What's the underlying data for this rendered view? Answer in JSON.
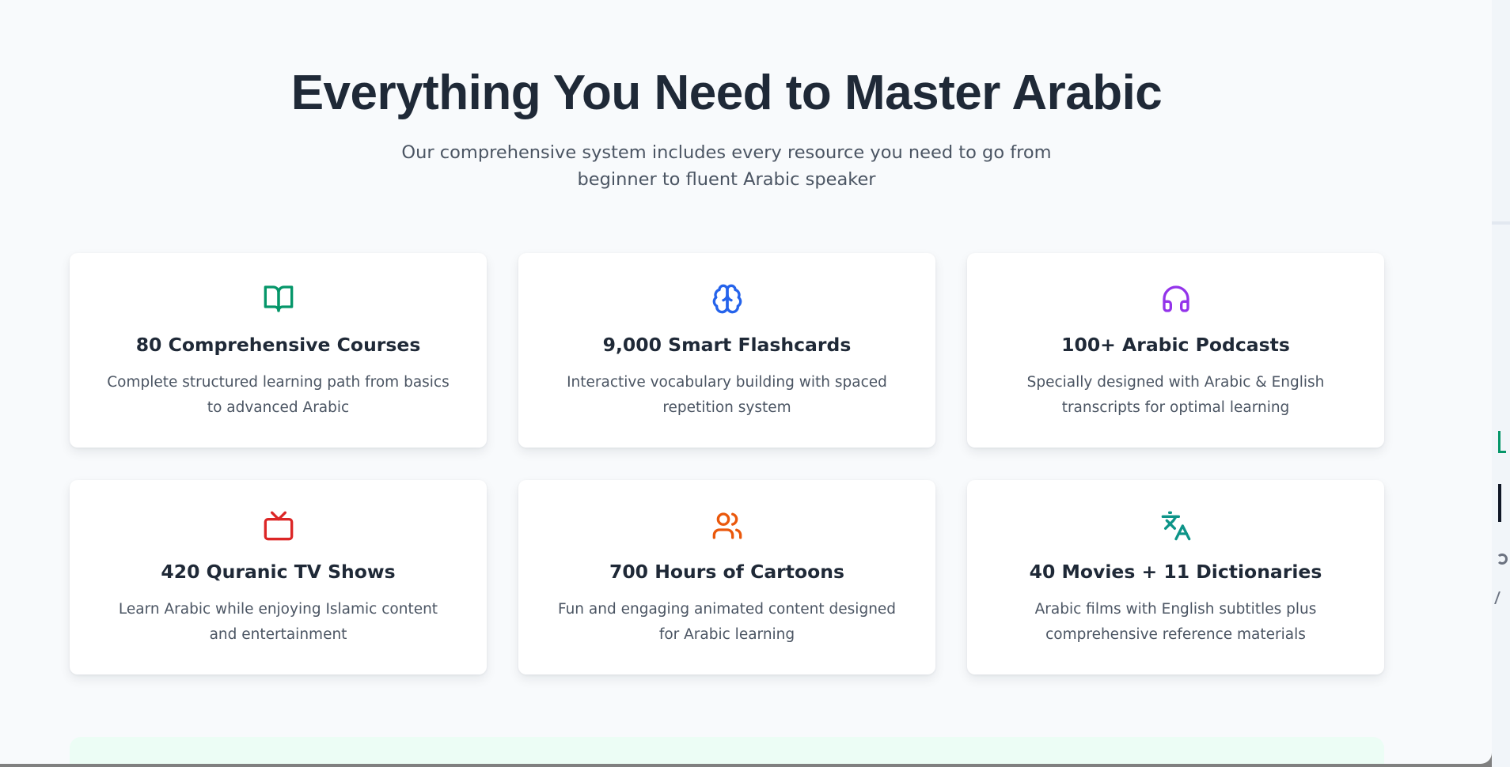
{
  "section": {
    "title": "Everything You Need to Master Arabic",
    "subtitle": "Our comprehensive system includes every resource you need to go from beginner to fluent Arabic speaker"
  },
  "features": [
    {
      "icon": "book-open-icon",
      "color": "#059669",
      "title": "80 Comprehensive Courses",
      "description": "Complete structured learning path from basics to advanced Arabic"
    },
    {
      "icon": "brain-icon",
      "color": "#2563eb",
      "title": "9,000 Smart Flashcards",
      "description": "Interactive vocabulary building with spaced repetition system"
    },
    {
      "icon": "headphones-icon",
      "color": "#9333ea",
      "title": "100+ Arabic Podcasts",
      "description": "Specially designed with Arabic & English transcripts for optimal learning"
    },
    {
      "icon": "tv-icon",
      "color": "#dc2626",
      "title": "420 Quranic TV Shows",
      "description": "Learn Arabic while enjoying Islamic content and entertainment"
    },
    {
      "icon": "users-icon",
      "color": "#ea580c",
      "title": "700 Hours of Cartoons",
      "description": "Fun and engaging animated content designed for Arabic learning"
    },
    {
      "icon": "languages-icon",
      "color": "#0d9488",
      "title": "40 Movies + 11 Dictionaries",
      "description": "Arabic films with English subtitles plus comprehensive reference materials"
    }
  ]
}
